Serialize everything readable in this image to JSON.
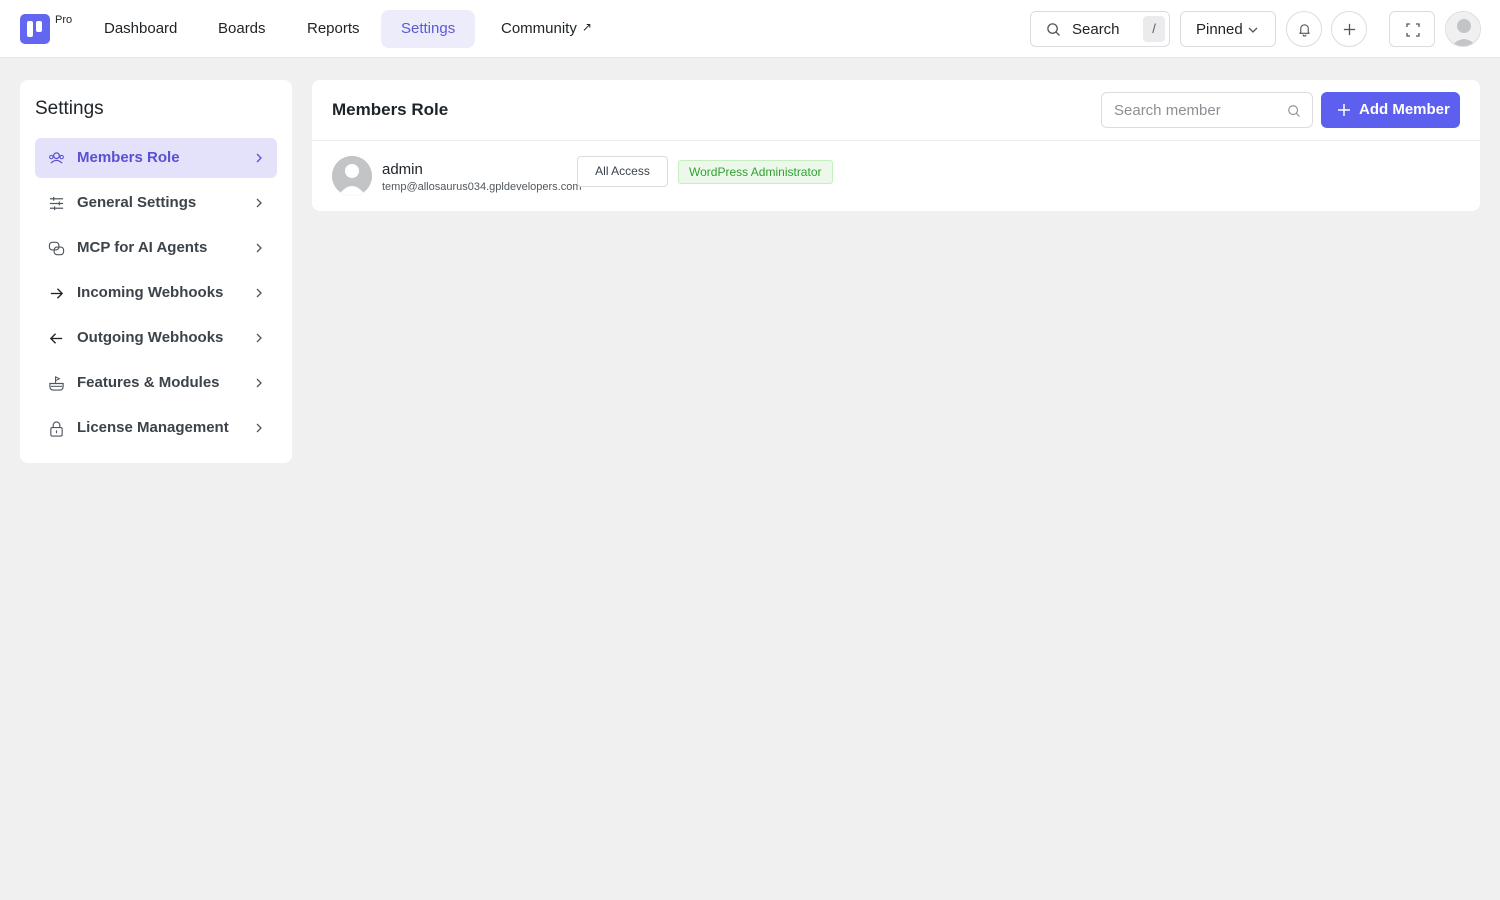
{
  "app": {
    "pro_label": "Pro"
  },
  "nav": [
    {
      "label": "Dashboard"
    },
    {
      "label": "Boards"
    },
    {
      "label": "Reports"
    },
    {
      "label": "Settings",
      "active": true
    },
    {
      "label": "Community",
      "external": "↗"
    }
  ],
  "topbar": {
    "search_label": "Search",
    "search_shortcut": "/",
    "pinned_label": "Pinned"
  },
  "sidebar": {
    "title": "Settings",
    "items": [
      {
        "label": "Members Role",
        "icon": "users-icon",
        "active": true
      },
      {
        "label": "General Settings",
        "icon": "sliders-icon"
      },
      {
        "label": "MCP for AI Agents",
        "icon": "mcp-icon"
      },
      {
        "label": "Incoming Webhooks",
        "icon": "arrow-right-icon"
      },
      {
        "label": "Outgoing Webhooks",
        "icon": "arrow-left-icon"
      },
      {
        "label": "Features & Modules",
        "icon": "modules-icon"
      },
      {
        "label": "License Management",
        "icon": "lock-icon"
      }
    ]
  },
  "main": {
    "title": "Members Role",
    "search_placeholder": "Search member",
    "add_button_label": "Add Member",
    "members": [
      {
        "name": "admin",
        "email": "temp@allosaurus034.gpldevelopers.com",
        "access": "All Access",
        "role": "WordPress Administrator"
      }
    ]
  },
  "colors": {
    "accent": "#5d5fef",
    "active_nav_bg": "#ececfb",
    "role_badge_text": "#2fa32f"
  }
}
